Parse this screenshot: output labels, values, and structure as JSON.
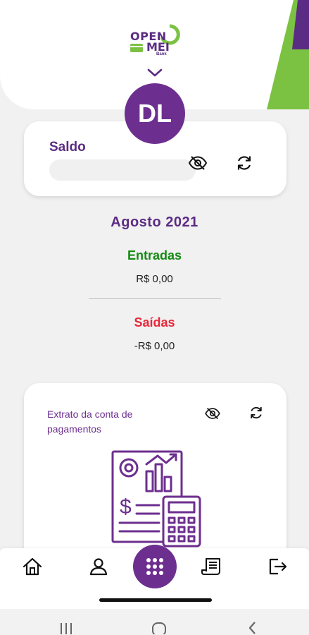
{
  "header": {
    "logo": {
      "word1": "OPEN",
      "word2": "MEI",
      "word3": "Bank"
    },
    "avatar_initials": "DL"
  },
  "balance": {
    "label": "Saldo"
  },
  "summary": {
    "month": "Agosto 2021",
    "entradas_label": "Entradas",
    "entradas_value": "R$ 0,00",
    "saidas_label": "Saídas",
    "saidas_value": "-R$ 0,00"
  },
  "statement": {
    "label": "Extrato da conta de pagamentos"
  },
  "colors": {
    "brand_purple": "#5b2c83",
    "accent_purple": "#6d2f8f",
    "brand_green": "#7cc242",
    "income_green": "#138a12",
    "expense_red": "#e8283a"
  },
  "icons": {
    "balance_card": [
      "eye-off-icon",
      "refresh-icon"
    ],
    "statement_card": [
      "eye-off-icon",
      "refresh-icon"
    ],
    "bottom_nav": [
      "home-icon",
      "user-icon",
      "grid-icon",
      "receipt-icon",
      "logout-icon"
    ],
    "system_nav": [
      "recent-apps-icon",
      "home-circle-icon",
      "back-icon"
    ]
  }
}
